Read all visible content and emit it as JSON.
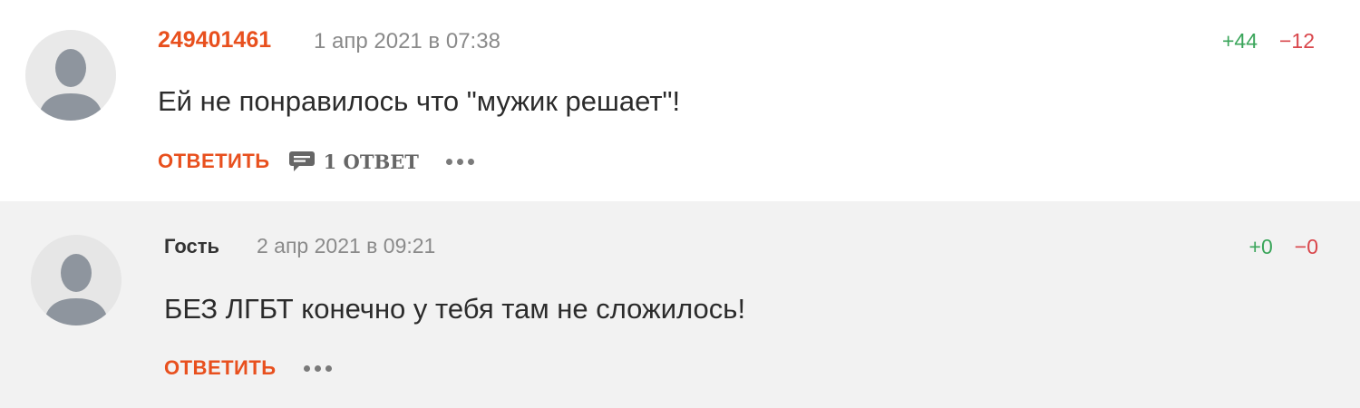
{
  "comments": [
    {
      "author": "249401461",
      "date": "1 апр 2021 в 07:38",
      "votes_up": "+44",
      "votes_down": "−12",
      "text": "Ей не понравилось что \"мужик решает\"!",
      "reply_label": "ОТВЕТИТЬ",
      "replies_label": "1 ОТВЕТ",
      "avatar_icon": "user-silhouette-icon",
      "replies_icon": "comment-bubble-icon",
      "more_icon": "more-dots-icon"
    },
    {
      "author": "Гость",
      "date": "2 апр 2021 в 09:21",
      "votes_up": "+0",
      "votes_down": "−0",
      "text": "БЕЗ ЛГБТ конечно у тебя там не сложилось!",
      "reply_label": "ОТВЕТИТЬ",
      "avatar_icon": "user-silhouette-icon",
      "more_icon": "more-dots-icon"
    }
  ],
  "colors": {
    "accent": "#e8501e",
    "vote_up": "#3aa55a",
    "vote_down": "#d9464b",
    "reply_background": "#f2f2f2",
    "avatar_figure": "#8e959e"
  }
}
